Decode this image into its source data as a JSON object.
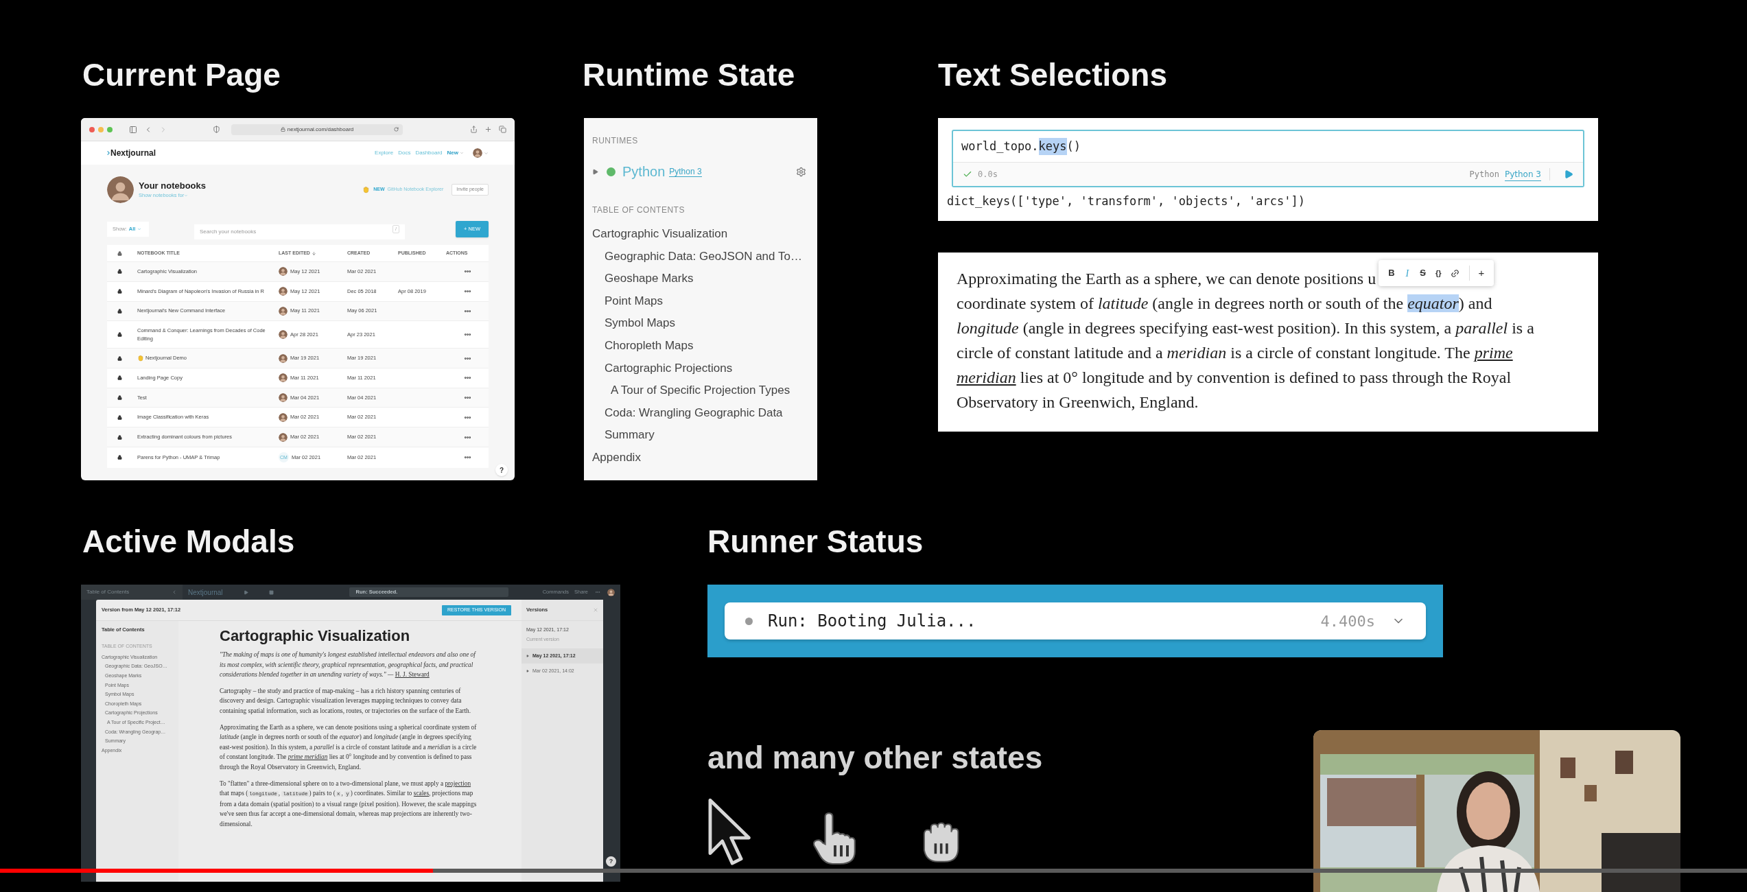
{
  "current_page": {
    "heading": "Current Page",
    "browser": {
      "url": "nextjournal.com/dashboard"
    },
    "site": {
      "logo": "Nextjournal",
      "nav": [
        {
          "label": "Explore",
          "kind": "link"
        },
        {
          "label": "Docs",
          "kind": "link"
        },
        {
          "label": "Dashboard",
          "kind": "link"
        },
        {
          "label": "New",
          "kind": "menu"
        }
      ]
    },
    "title": "Your notebooks",
    "subtitle": "Show notebooks for",
    "promo_badge": "NEW",
    "promo_link": "GitHub Notebook Explorer",
    "invite_button": "Invite people",
    "filter_label": "Show:",
    "filter_value": "All",
    "search_placeholder": "Search your notebooks",
    "search_key": "/",
    "new_button": "+ NEW",
    "columns": [
      {
        "label": "NOTEBOOK TITLE",
        "sorted": false
      },
      {
        "label": "LAST EDITED",
        "sorted": true
      },
      {
        "label": "CREATED",
        "sorted": false
      },
      {
        "label": "PUBLISHED",
        "sorted": false
      },
      {
        "label": "ACTIONS",
        "sorted": false
      }
    ],
    "rows": [
      {
        "title": "Cartographic Visualization",
        "emoji": false,
        "last_edited": "May 12 2021",
        "created": "Mar 02 2021"
      },
      {
        "title": "Minard's Diagram of Napoleon's Invasion of Russia in R",
        "emoji": false,
        "last_edited": "May 12 2021",
        "created": "Dec 05 2018",
        "published": "Apr 08 2019"
      },
      {
        "title": "Nextjournal's New Command Interface",
        "emoji": false,
        "last_edited": "May 11 2021",
        "created": "May 06 2021"
      },
      {
        "title": "Command & Conquer: Learnings from Decades of Code Editing",
        "emoji": false,
        "last_edited": "Apr 28 2021",
        "created": "Apr 23 2021"
      },
      {
        "title": "Nextjournal Demo",
        "emoji": true,
        "last_edited": "Mar 19 2021",
        "created": "Mar 19 2021"
      },
      {
        "title": "Landing Page Copy",
        "emoji": false,
        "last_edited": "Mar 11 2021",
        "created": "Mar 11 2021"
      },
      {
        "title": "Test",
        "emoji": false,
        "last_edited": "Mar 04 2021",
        "created": "Mar 04 2021"
      },
      {
        "title": "Image Classification with Keras",
        "emoji": false,
        "last_edited": "Mar 02 2021",
        "created": "Mar 02 2021"
      },
      {
        "title": "Extracting dominant colours from pictures",
        "emoji": false,
        "last_edited": "Mar 02 2021",
        "created": "Mar 02 2021"
      },
      {
        "title": "Parens for Python - UMAP & Trimap",
        "emoji": false,
        "initials": "CM",
        "last_edited": "Mar 02 2021",
        "created": "Mar 02 2021"
      }
    ],
    "help": "?"
  },
  "runtime_state": {
    "heading": "Runtime State",
    "runtimes_label": "RUNTIMES",
    "runtime": {
      "name": "Python",
      "version": "Python 3",
      "running": true
    },
    "toc_label": "TABLE OF CONTENTS",
    "toc": [
      {
        "label": "Cartographic Visualization",
        "children": [
          {
            "label": "Geographic Data: GeoJSON and To…"
          },
          {
            "label": "Geoshape Marks"
          },
          {
            "label": "Point Maps"
          },
          {
            "label": "Symbol Maps"
          },
          {
            "label": "Choropleth Maps"
          },
          {
            "label": "Cartographic Projections",
            "children": [
              {
                "label": "A Tour of Specific Projection Types"
              }
            ]
          },
          {
            "label": "Coda: Wrangling Geographic Data"
          },
          {
            "label": "Summary"
          }
        ]
      },
      {
        "label": "Appendix"
      }
    ]
  },
  "text_selections": {
    "heading": "Text Selections",
    "code_cell": {
      "code": [
        {
          "text": "world_topo.",
          "kind": "plain"
        },
        {
          "text": "keys",
          "kind": "selection"
        },
        {
          "text": "()",
          "kind": "plain"
        }
      ],
      "succeeded": true,
      "duration": "0.0s",
      "language": "Python",
      "version": "Python 3",
      "output": "dict_keys(['type', 'transform', 'objects', 'arcs'])"
    },
    "toolbar": [
      {
        "kind": "bold",
        "label": "B",
        "active": false
      },
      {
        "kind": "italic",
        "label": "I",
        "active": true
      },
      {
        "kind": "strike",
        "label": "S",
        "active": false
      },
      {
        "kind": "code",
        "label": "{}",
        "active": false
      },
      {
        "kind": "link",
        "active": false
      },
      {
        "kind": "plus",
        "label": "+",
        "active": false
      }
    ],
    "lines": [
      [
        {
          "text": "Approximating the Earth as a sphere, we can denote positions u",
          "kind": "plain"
        }
      ],
      [
        {
          "text": "coordinate system of ",
          "kind": "plain"
        },
        {
          "text": "latitude",
          "kind": "italic"
        },
        {
          "text": " (angle in degrees north or south of the ",
          "kind": "plain"
        },
        {
          "text": "equator",
          "kind": "selection"
        },
        {
          "text": ") and",
          "kind": "plain"
        }
      ],
      [
        {
          "text": "longitude",
          "kind": "italic"
        },
        {
          "text": " (angle in degrees specifying east-west position). In this system, a ",
          "kind": "plain"
        },
        {
          "text": "parallel",
          "kind": "italic"
        },
        {
          "text": " is a",
          "kind": "plain"
        }
      ],
      [
        {
          "text": "circle of constant latitude and a ",
          "kind": "plain"
        },
        {
          "text": "meridian",
          "kind": "italic"
        },
        {
          "text": " is a circle of constant longitude. The ",
          "kind": "plain"
        },
        {
          "text": "prime",
          "kind": "link_italic"
        }
      ],
      [
        {
          "text": "meridian",
          "kind": "link_italic"
        },
        {
          "text": " lies at 0° longitude and by convention is defined to pass through the Royal",
          "kind": "plain"
        }
      ],
      [
        {
          "text": "Observatory in Greenwich, England.",
          "kind": "plain"
        }
      ]
    ]
  },
  "active_modals": {
    "heading": "Active Modals",
    "app_bar": {
      "toc_title": "Table of Contents",
      "logo": "Nextjournal",
      "run_status": "Run: Succeeded.",
      "commands": "Commands",
      "share": "Share"
    },
    "modal": {
      "title": "Version from May 12 2021, 17:12",
      "restore_button": "RESTORE THIS VERSION",
      "versions_title": "Versions",
      "toc_title": "Table of Contents",
      "toc_label": "TABLE OF CONTENTS",
      "toc": [
        {
          "label": "Cartographic Visualization",
          "children": [
            {
              "label": "Geographic Data: GeoJSO…"
            },
            {
              "label": "Geoshape Marks"
            },
            {
              "label": "Point Maps"
            },
            {
              "label": "Symbol Maps"
            },
            {
              "label": "Choropleth Maps"
            },
            {
              "label": "Cartographic Projections",
              "children": [
                {
                  "label": "A Tour of Specific Project…"
                }
              ]
            },
            {
              "label": "Coda: Wrangling Geograp…"
            },
            {
              "label": "Summary"
            }
          ]
        },
        {
          "label": "Appendix"
        }
      ],
      "doc_title": "Cartographic Visualization",
      "paragraphs": [
        [
          {
            "text": "\"The making of maps is one of humanity's longest established intellectual endeavors and also one of its most complex, with scientific theory, graphical representation, geographical facts, and practical considerations blended together in an unending variety of ways.\" — ",
            "kind": "italic"
          },
          {
            "text": "H. J. Steward",
            "kind": "link"
          }
        ],
        [
          {
            "text": "Cartography – the study and practice of map-making – has a rich history spanning centuries of discovery and design. Cartographic visualization leverages mapping techniques to convey data containing spatial information, such as locations, routes, or trajectories on the surface of the Earth.",
            "kind": "plain"
          }
        ],
        [
          {
            "text": "Approximating the Earth as a sphere, we can denote positions using a spherical coordinate system of ",
            "kind": "plain"
          },
          {
            "text": "latitude",
            "kind": "italic"
          },
          {
            "text": " (angle in degrees north or south of the ",
            "kind": "plain"
          },
          {
            "text": "equator",
            "kind": "italic"
          },
          {
            "text": ") and ",
            "kind": "plain"
          },
          {
            "text": "longitude",
            "kind": "italic"
          },
          {
            "text": " (angle in degrees specifying east-west position). In this system, a ",
            "kind": "plain"
          },
          {
            "text": "parallel",
            "kind": "italic"
          },
          {
            "text": " is a circle of constant latitude and a ",
            "kind": "plain"
          },
          {
            "text": "meridian",
            "kind": "italic"
          },
          {
            "text": " is a circle of constant longitude. The ",
            "kind": "plain"
          },
          {
            "text": "prime meridian",
            "kind": "link_italic"
          },
          {
            "text": " lies at 0° longitude and by convention is defined to pass through the Royal Observatory in Greenwich, England.",
            "kind": "plain"
          }
        ],
        [
          {
            "text": "To \"flatten\" a three-dimensional sphere on to a two-dimensional plane, we must apply a ",
            "kind": "plain"
          },
          {
            "text": "projection",
            "kind": "link"
          },
          {
            "text": " that maps (",
            "kind": "plain"
          },
          {
            "text": "longitude",
            "kind": "code"
          },
          {
            "text": ", ",
            "kind": "plain"
          },
          {
            "text": "latitude",
            "kind": "code"
          },
          {
            "text": ") pairs to (",
            "kind": "plain"
          },
          {
            "text": "x",
            "kind": "code"
          },
          {
            "text": ", ",
            "kind": "plain"
          },
          {
            "text": "y",
            "kind": "code"
          },
          {
            "text": ") coordinates. Similar to ",
            "kind": "plain"
          },
          {
            "text": "scales",
            "kind": "link"
          },
          {
            "text": ", projections map from a data domain (spatial position) to a visual range (pixel position). However, the scale mappings we've seen thus far accept a one-dimensional domain, whereas map projections are inherently two-dimensional.",
            "kind": "plain"
          }
        ]
      ],
      "current_version": {
        "label": "May 12 2021, 17:12",
        "note": "Current version"
      },
      "versions": [
        {
          "label": "May 12 2021, 17:12",
          "selected": true
        },
        {
          "label": "Mar 02 2021, 14:02",
          "selected": false
        }
      ],
      "help": "?"
    }
  },
  "runner_status": {
    "heading": "Runner Status",
    "status": "Run: Booting Julia...",
    "kind": "booting",
    "time": "4.400s"
  },
  "other_states": {
    "heading": "and many other states"
  },
  "video": {
    "progress": {
      "level": 0.248
    }
  }
}
